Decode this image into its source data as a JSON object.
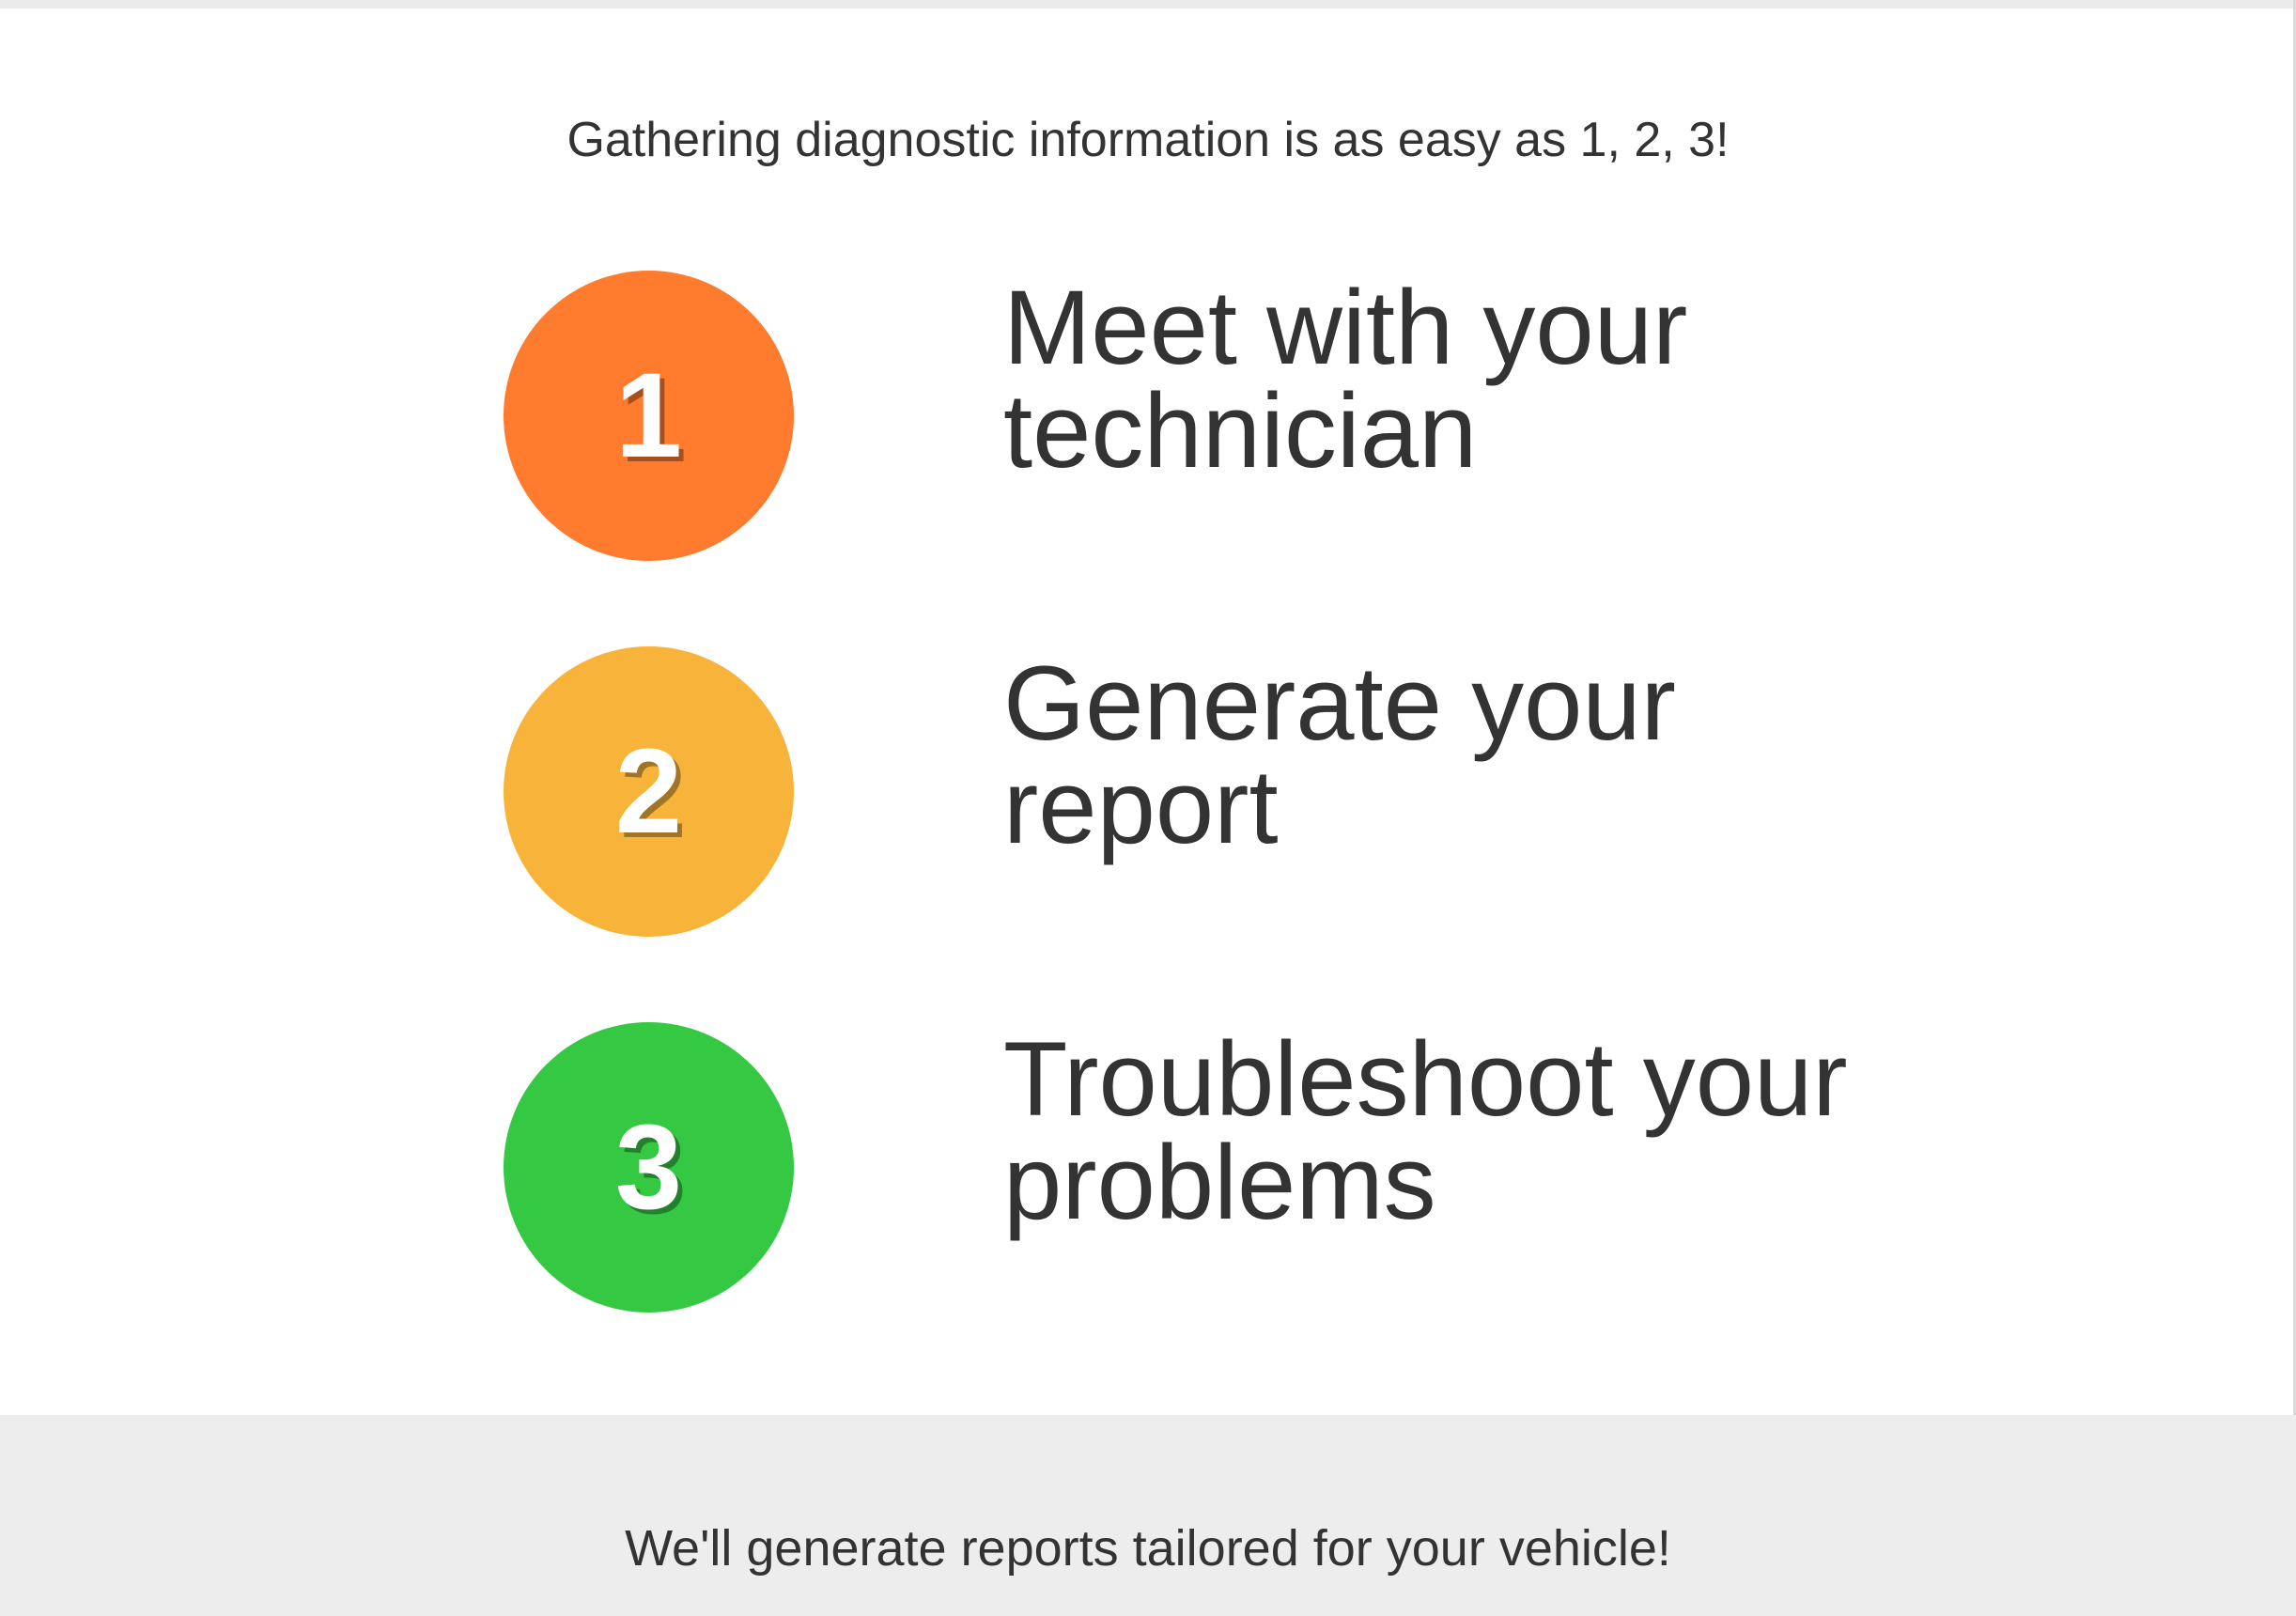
{
  "intro": {
    "text": "Gathering diagnostic information is as easy as 1, 2, 3!"
  },
  "steps": [
    {
      "number": "1",
      "line1": "Meet with your",
      "line2": "technician",
      "color": "#ff7b2e"
    },
    {
      "number": "2",
      "line1": "Generate your",
      "line2": "report",
      "color": "#f8b43a"
    },
    {
      "number": "3",
      "line1": "Troubleshoot your",
      "line2": "problems",
      "color": "#35c842"
    }
  ],
  "footer": {
    "text": "We'll generate reports tailored for your vehicle!"
  }
}
